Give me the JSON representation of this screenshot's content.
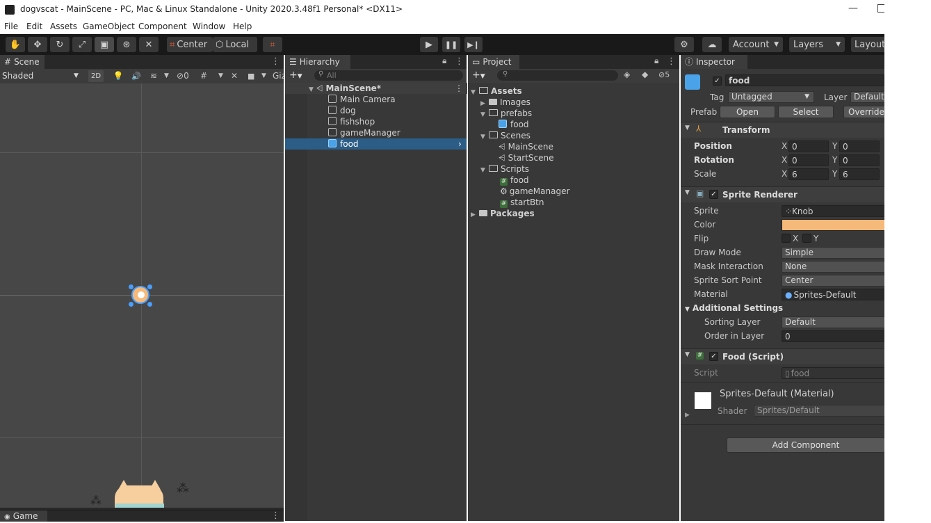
{
  "window": {
    "title": "dogvscat - MainScene - PC, Mac & Linux Standalone - Unity 2020.3.48f1 Personal* <DX11>",
    "minimize": "—"
  },
  "menu": [
    "File",
    "Edit",
    "Assets",
    "GameObject",
    "Component",
    "Window",
    "Help"
  ],
  "toolbar": {
    "pivot": "Center",
    "space": "Local",
    "account": "Account",
    "layers": "Layers",
    "layout": "Layout"
  },
  "scene": {
    "tab": "Scene",
    "shading": "Shaded",
    "mode2d": "2D",
    "hidden_count": "0",
    "gizmos": "Giz"
  },
  "game": {
    "tab": "Game"
  },
  "hierarchy": {
    "tab": "Hierarchy",
    "search_placeholder": "All",
    "scene": "MainScene*",
    "items": [
      "Main Camera",
      "dog",
      "fishshop",
      "gameManager",
      "food"
    ]
  },
  "project": {
    "tab": "Project",
    "badge_count": "5",
    "tree": [
      {
        "label": "Assets"
      },
      {
        "label": "Images"
      },
      {
        "label": "prefabs"
      },
      {
        "label": "food"
      },
      {
        "label": "Scenes"
      },
      {
        "label": "MainScene"
      },
      {
        "label": "StartScene"
      },
      {
        "label": "Scripts"
      },
      {
        "label": "food"
      },
      {
        "label": "gameManager"
      },
      {
        "label": "startBtn"
      },
      {
        "label": "Packages"
      }
    ]
  },
  "inspector": {
    "tab": "Inspector",
    "object_name": "food",
    "tag_label": "Tag",
    "tag_value": "Untagged",
    "layer_label": "Layer",
    "layer_value": "Default",
    "prefab_label": "Prefab",
    "prefab_open": "Open",
    "prefab_select": "Select",
    "prefab_overrides": "Overrides",
    "transform": {
      "title": "Transform",
      "position": "Position",
      "rotation": "Rotation",
      "scale": "Scale",
      "x": "X",
      "y": "Y",
      "pos_x": "0",
      "pos_y": "0",
      "rot_x": "0",
      "rot_y": "0",
      "scale_x": "6",
      "scale_y": "6"
    },
    "sprite_renderer": {
      "title": "Sprite Renderer",
      "sprite_label": "Sprite",
      "sprite_value": "Knob",
      "color_label": "Color",
      "color_value": "#f5b97a",
      "flip_label": "Flip",
      "flip_x": "X",
      "flip_y": "Y",
      "draw_mode_label": "Draw Mode",
      "draw_mode_value": "Simple",
      "mask_label": "Mask Interaction",
      "mask_value": "None",
      "sort_point_label": "Sprite Sort Point",
      "sort_point_value": "Center",
      "material_label": "Material",
      "material_value": "Sprites-Default",
      "additional": "Additional Settings",
      "sorting_layer_label": "Sorting Layer",
      "sorting_layer_value": "Default",
      "order_label": "Order in Layer",
      "order_value": "0"
    },
    "food_script": {
      "title": "Food (Script)",
      "script_label": "Script",
      "script_value": "food"
    },
    "material": {
      "name": "Sprites-Default (Material)",
      "shader_label": "Shader",
      "shader_value": "Sprites/Default"
    },
    "add_component": "Add Component"
  }
}
